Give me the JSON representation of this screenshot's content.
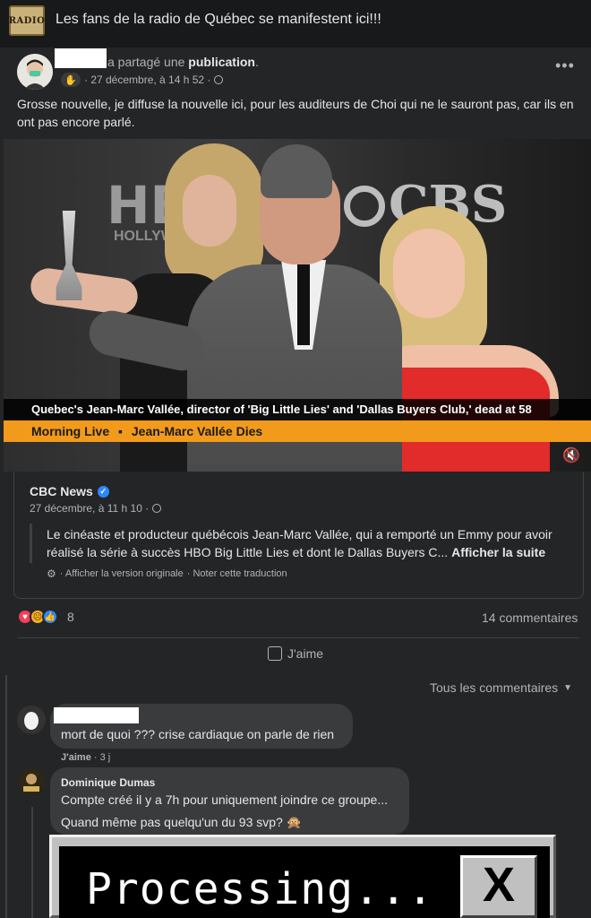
{
  "group": {
    "logo_text": "RADIO",
    "title": "Les fans de la radio de Québec se manifestent ici!!!"
  },
  "post": {
    "shared_prefix": "a partagé une ",
    "shared_object": "publication",
    "shared_suffix": ".",
    "timestamp": "· 27 décembre, à 14 h 52 ·",
    "text": "Grosse nouvelle, je diffuse la nouvelle ici, pour les auditeurs de Choi qui ne le sauront pas, car ils en ont pas encore parlé.",
    "more_label": "•••"
  },
  "media": {
    "backdrop_left": "HB",
    "backdrop_left_sub": "HOLLYW",
    "backdrop_right": "CBS",
    "caption_headline": "Quebec's Jean-Marc Vallée, director of 'Big Little Lies' and 'Dallas Buyers Club,' dead at 58",
    "caption_show": "Morning Live",
    "caption_topic": "Jean-Marc Vallée Dies",
    "caption_separator": "▪",
    "mute_icon": "speaker-muted-icon"
  },
  "shared_post": {
    "page_name": "CBC News",
    "timestamp": "27 décembre, à 11 h 10 ·",
    "text": "Le cinéaste et producteur québécois Jean-Marc Vallée, qui a remporté un Emmy pour avoir réalisé la série à succès HBO Big Little Lies et dont le Dallas Buyers C...",
    "see_more": "Afficher la suite",
    "view_original": "· Afficher la version originale",
    "rate_translation": "· Noter cette traduction"
  },
  "engagement": {
    "reaction_count": "8",
    "comment_count": "14 commentaires",
    "like_label": "J'aime"
  },
  "comments": {
    "sort_label": "Tous les commentaires",
    "items": [
      {
        "text": "mort de quoi ??? crise cardiaque on parle de rien",
        "like_label": "J'aime",
        "age": "· 3 j"
      },
      {
        "author": "Dominique Dumas",
        "line1": "Compte créé il y a 7h pour uniquement joindre ce groupe...",
        "line2": "Quand même pas quelqu'un du 93 svp?",
        "emoji": "🙊"
      }
    ]
  },
  "gif": {
    "text": "Processing...",
    "close": "X"
  },
  "colors": {
    "background": "#18191a",
    "card": "#242526",
    "bubble": "#3a3b3c",
    "accent_blue": "#2d88ff",
    "caption_orange": "#f19a1c"
  }
}
